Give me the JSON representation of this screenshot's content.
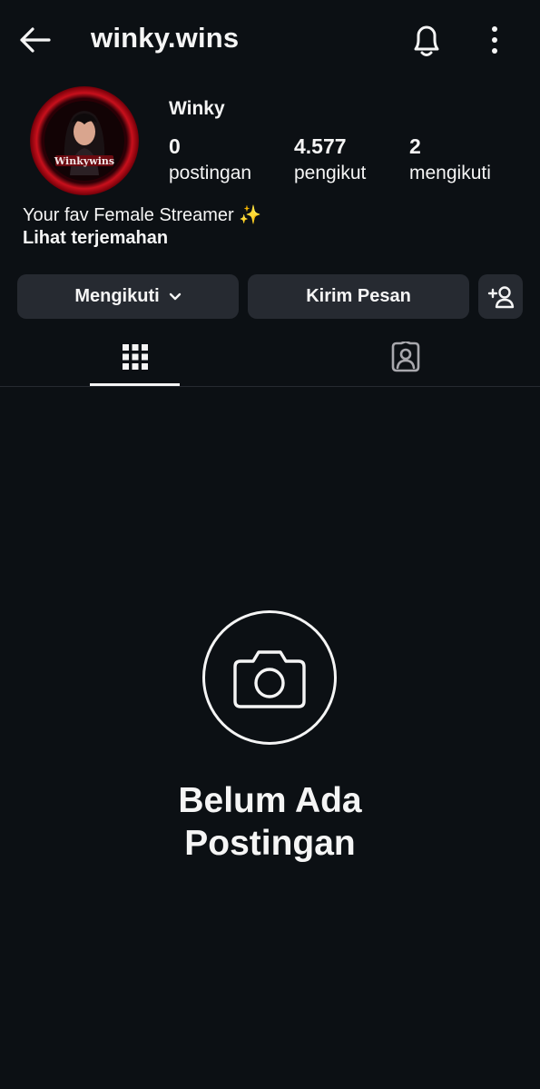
{
  "header": {
    "username": "winky.wins",
    "icons": {
      "back": "arrow-left-icon",
      "notifications": "bell-icon",
      "more": "more-vertical-icon"
    }
  },
  "profile": {
    "display_name": "Winky",
    "avatar_text": "Winkywins",
    "stats": [
      {
        "value": "0",
        "label": "postingan"
      },
      {
        "value": "4.577",
        "label": "pengikut"
      },
      {
        "value": "2",
        "label": "mengikuti"
      }
    ],
    "bio": "Your fav Female Streamer ✨",
    "translate_link": "Lihat terjemahan"
  },
  "actions": {
    "follow_label": "Mengikuti",
    "message_label": "Kirim Pesan",
    "add_user_icon": "add-user-icon"
  },
  "tabs": [
    {
      "name": "posts-grid",
      "icon": "grid-icon",
      "active": true
    },
    {
      "name": "tagged",
      "icon": "tagged-person-icon",
      "active": false
    }
  ],
  "empty_state": {
    "icon": "camera-icon",
    "title": "Belum Ada Postingan"
  },
  "colors": {
    "background": "#0c1014",
    "button": "#262a31",
    "text": "#f5f5f5",
    "avatar_ring": "#c8101c"
  }
}
